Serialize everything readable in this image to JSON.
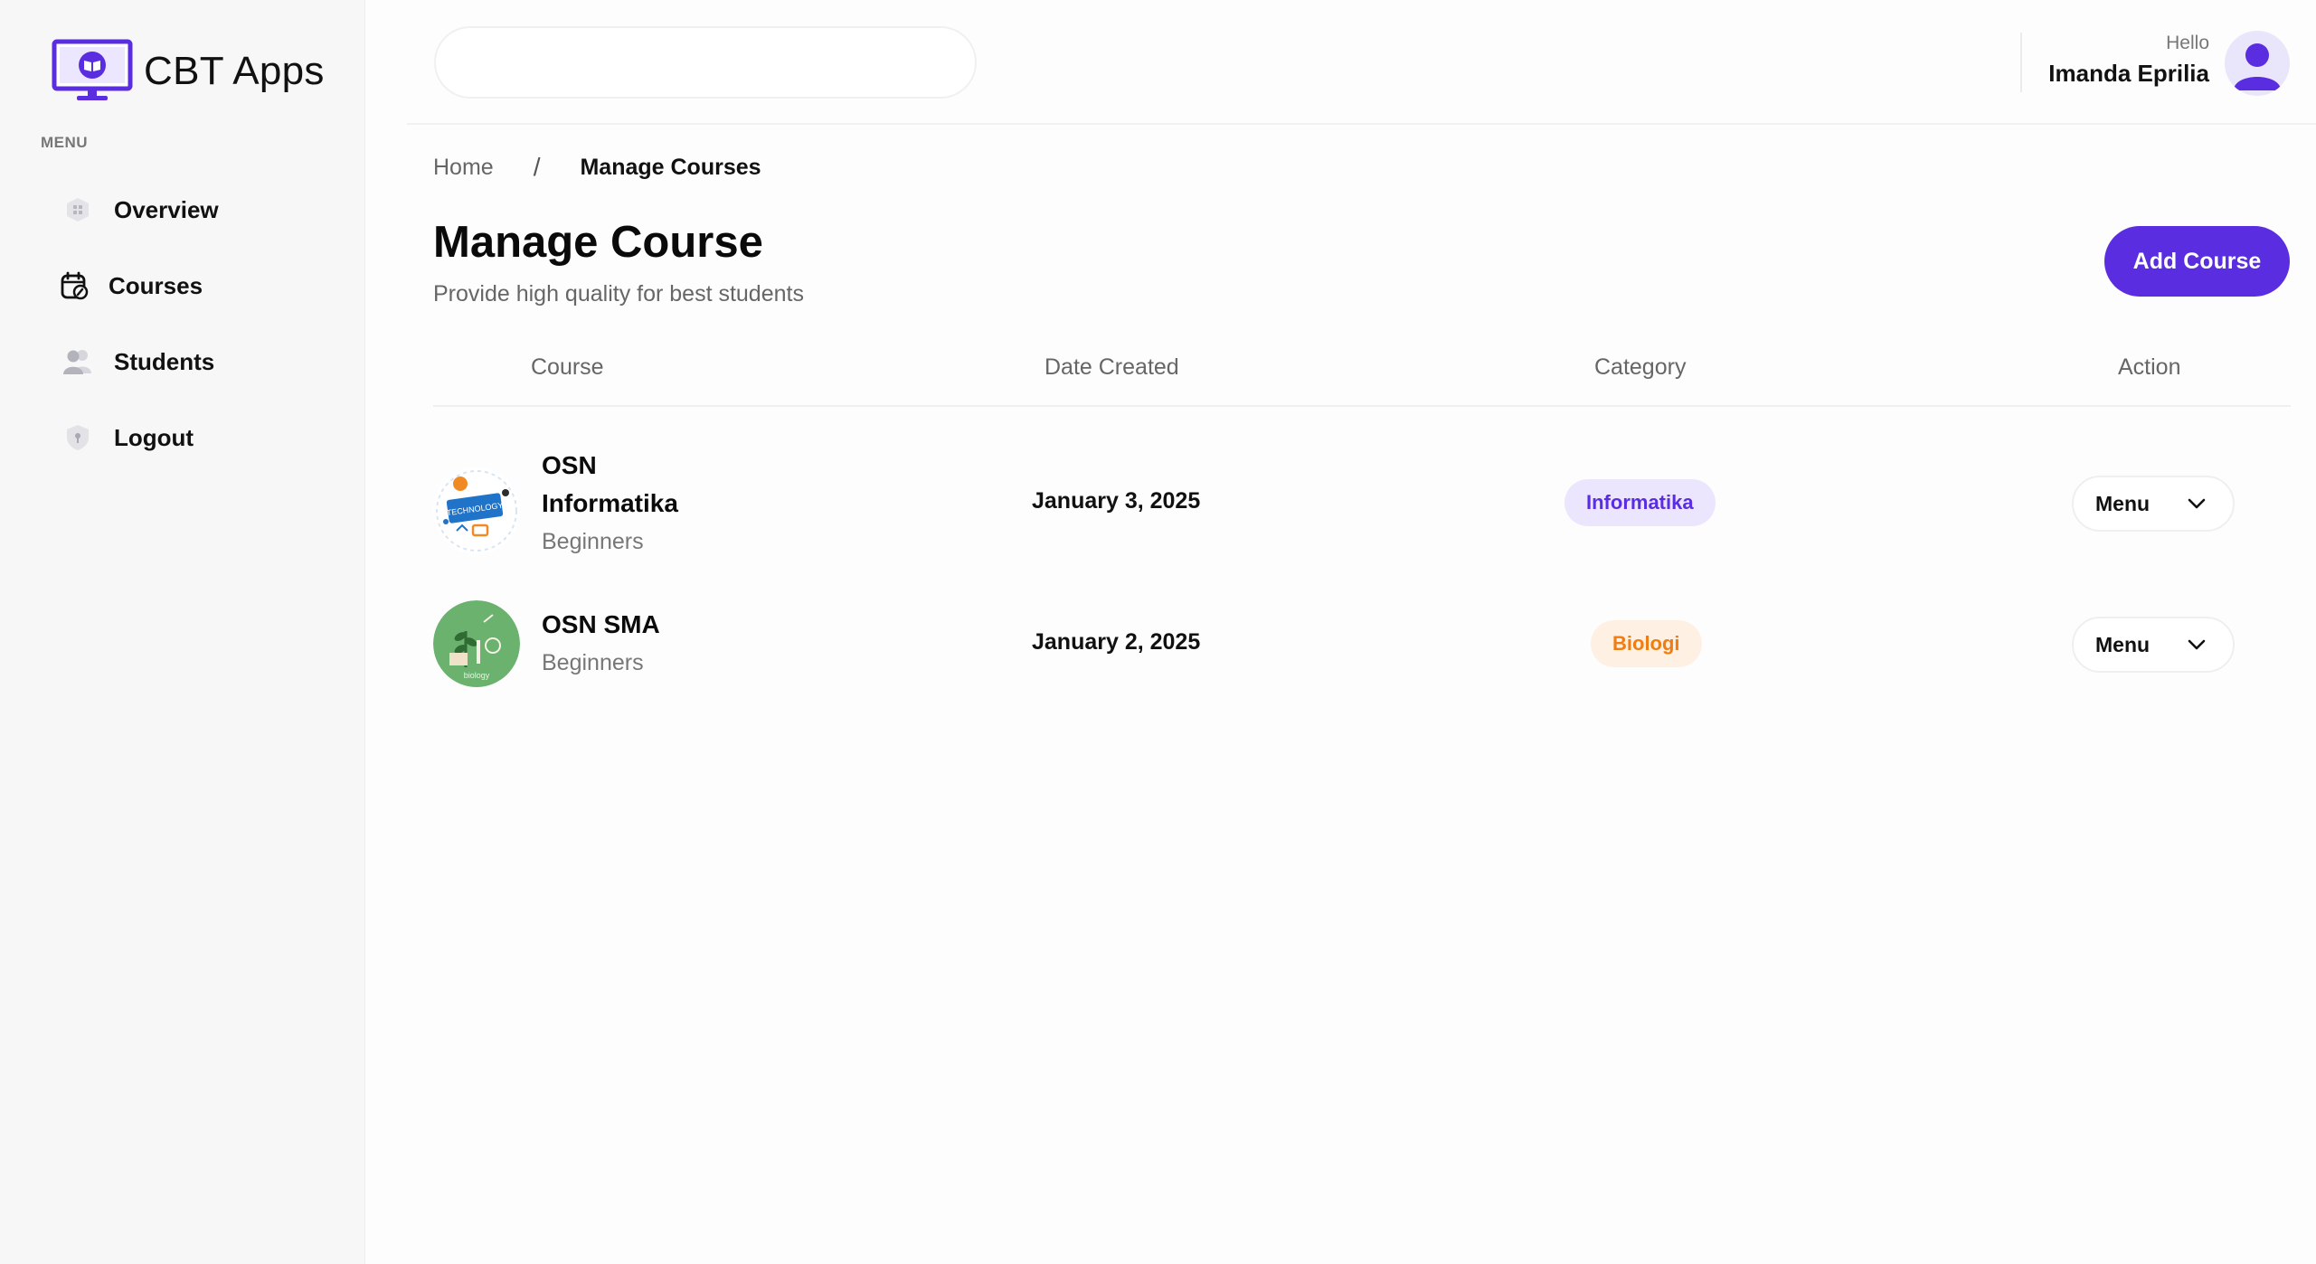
{
  "brand": {
    "name": "CBT Apps"
  },
  "sidebar": {
    "menu_heading": "MENU",
    "items": [
      {
        "label": "Overview",
        "icon": "grid-icon"
      },
      {
        "label": "Courses",
        "icon": "calendar-edit-icon"
      },
      {
        "label": "Students",
        "icon": "users-icon"
      },
      {
        "label": "Logout",
        "icon": "shield-icon"
      }
    ]
  },
  "topbar": {
    "search_placeholder": "",
    "greeting": "Hello",
    "user_name": "Imanda Eprilia"
  },
  "breadcrumb": {
    "home": "Home",
    "separator": "/",
    "current": "Manage Courses"
  },
  "page": {
    "title": "Manage Course",
    "subtitle": "Provide high quality for best students",
    "add_button": "Add Course"
  },
  "table": {
    "headers": {
      "course": "Course",
      "date": "Date Created",
      "category": "Category",
      "action": "Action"
    },
    "rows": [
      {
        "name_line1": "OSN",
        "name_line2": "Informatika",
        "level": "Beginners",
        "date": "January 3, 2025",
        "category": "Informatika",
        "action": "Menu",
        "thumb_label": "TECHNOLOGY"
      },
      {
        "name_line1": "OSN SMA",
        "level": "Beginners",
        "date": "January 2, 2025",
        "category": "Biologi",
        "action": "Menu",
        "thumb_label": "biology"
      }
    ]
  },
  "colors": {
    "accent": "#5a2de0",
    "badge_info_bg": "#ebe6fd",
    "badge_bio_bg": "#fff0e4",
    "badge_bio_text": "#f07d12"
  }
}
